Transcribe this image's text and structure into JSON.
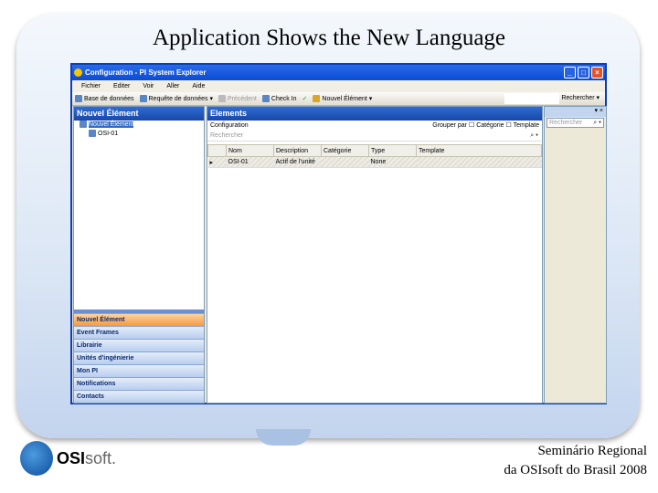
{
  "slide": {
    "title": "Application Shows the New Language",
    "footer_line1": "Seminário Regional",
    "footer_line2": "da OSIsoft do Brasil 2008",
    "logo_bold": "OSI",
    "logo_light": "soft."
  },
  "window": {
    "title": "Configuration - PI System Explorer",
    "menu": [
      "Fichier",
      "Editer",
      "Voir",
      "Aller",
      "Aide"
    ],
    "toolbar": {
      "database": "Base de données",
      "query": "Requête de données",
      "back": "Précédent",
      "checkin": "Check In",
      "new_element": "Nouvel Élément",
      "search": "Rechercher"
    }
  },
  "left": {
    "header": "Nouvel Élément",
    "tree": [
      "Nouvel Élément",
      "OSI-01"
    ],
    "nav": [
      "Nouvel Élément",
      "Event Frames",
      "Librairie",
      "Unités d'ingénierie",
      "Mon PI",
      "Notifications",
      "Contacts"
    ]
  },
  "main": {
    "header": "Elements",
    "breadcrumb": "Configuration",
    "group_by": "Grouper par",
    "category": "Catégorie",
    "template": "Template",
    "search_placeholder": "Rechercher",
    "columns": [
      "Nom",
      "Description",
      "Catégorie",
      "Type",
      "Template"
    ],
    "rows": [
      {
        "name": "OSI-01",
        "description": "Actif de l'unité",
        "category": "",
        "type": "None",
        "template": ""
      }
    ]
  },
  "right": {
    "search_placeholder": "Rechercher"
  }
}
